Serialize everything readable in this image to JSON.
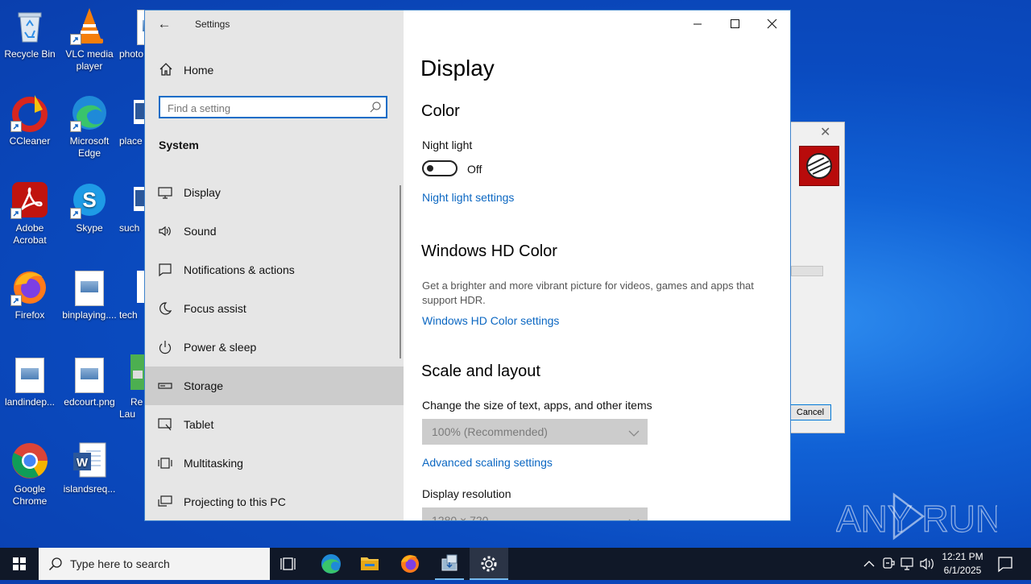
{
  "desktop": {
    "icons": [
      {
        "label": "Recycle Bin",
        "icon": "recycle-bin-icon"
      },
      {
        "label": "VLC media player",
        "icon": "vlc-icon"
      },
      {
        "label": "photo",
        "icon": "image-file-icon"
      },
      {
        "label": "CCleaner",
        "icon": "ccleaner-icon"
      },
      {
        "label": "Microsoft Edge",
        "icon": "edge-icon"
      },
      {
        "label": "place",
        "icon": "word-icon"
      },
      {
        "label": "Adobe Acrobat",
        "icon": "acrobat-icon"
      },
      {
        "label": "Skype",
        "icon": "skype-icon"
      },
      {
        "label": "such",
        "icon": "word-icon"
      },
      {
        "label": "Firefox",
        "icon": "firefox-icon"
      },
      {
        "label": "binplaying....",
        "icon": "image-file-icon"
      },
      {
        "label": "tech",
        "icon": "image-file-icon"
      },
      {
        "label": "landindep...",
        "icon": "image-file-icon"
      },
      {
        "label": "edcourt.png",
        "icon": "image-file-icon"
      },
      {
        "label": "Re Lau",
        "icon": "app-icon"
      },
      {
        "label": "Google Chrome",
        "icon": "chrome-icon"
      },
      {
        "label": "islandsreq...",
        "icon": "word-icon"
      }
    ]
  },
  "background_dialog": {
    "cancel_label": "Cancel",
    "close_glyph": "✕"
  },
  "window": {
    "title": "Settings",
    "back_glyph": "←",
    "sidebar": {
      "home_label": "Home",
      "search_placeholder": "Find a setting",
      "section_label": "System",
      "items": [
        {
          "label": "Display",
          "icon": "monitor-icon",
          "active": false
        },
        {
          "label": "Sound",
          "icon": "speaker-icon",
          "active": false
        },
        {
          "label": "Notifications & actions",
          "icon": "notification-icon",
          "active": false
        },
        {
          "label": "Focus assist",
          "icon": "moon-icon",
          "active": false
        },
        {
          "label": "Power & sleep",
          "icon": "power-icon",
          "active": false
        },
        {
          "label": "Storage",
          "icon": "storage-icon",
          "active": true
        },
        {
          "label": "Tablet",
          "icon": "tablet-icon",
          "active": false
        },
        {
          "label": "Multitasking",
          "icon": "multitasking-icon",
          "active": false
        },
        {
          "label": "Projecting to this PC",
          "icon": "projecting-icon",
          "active": false
        }
      ]
    },
    "content": {
      "page_title": "Display",
      "color": {
        "heading": "Color",
        "night_light_label": "Night light",
        "night_light_state": "Off",
        "night_light_link": "Night light settings"
      },
      "hdr": {
        "heading": "Windows HD Color",
        "description": "Get a brighter and more vibrant picture for videos, games and apps that support HDR.",
        "link": "Windows HD Color settings"
      },
      "scale": {
        "heading": "Scale and layout",
        "size_label": "Change the size of text, apps, and other items",
        "size_value": "100% (Recommended)",
        "advanced_link": "Advanced scaling settings",
        "resolution_label": "Display resolution",
        "resolution_value": "1280 × 720"
      }
    }
  },
  "taskbar": {
    "search_placeholder": "Type here to search",
    "apps": [
      {
        "name": "task-view",
        "icon": "task-view-icon"
      },
      {
        "name": "edge",
        "icon": "edge-icon"
      },
      {
        "name": "file-explorer",
        "icon": "folder-icon"
      },
      {
        "name": "firefox",
        "icon": "firefox-icon"
      },
      {
        "name": "installer",
        "icon": "installer-icon"
      },
      {
        "name": "settings",
        "icon": "gear-icon"
      }
    ],
    "time": "12:21 PM",
    "date": "6/1/2025"
  },
  "watermark": "ANY RUN"
}
